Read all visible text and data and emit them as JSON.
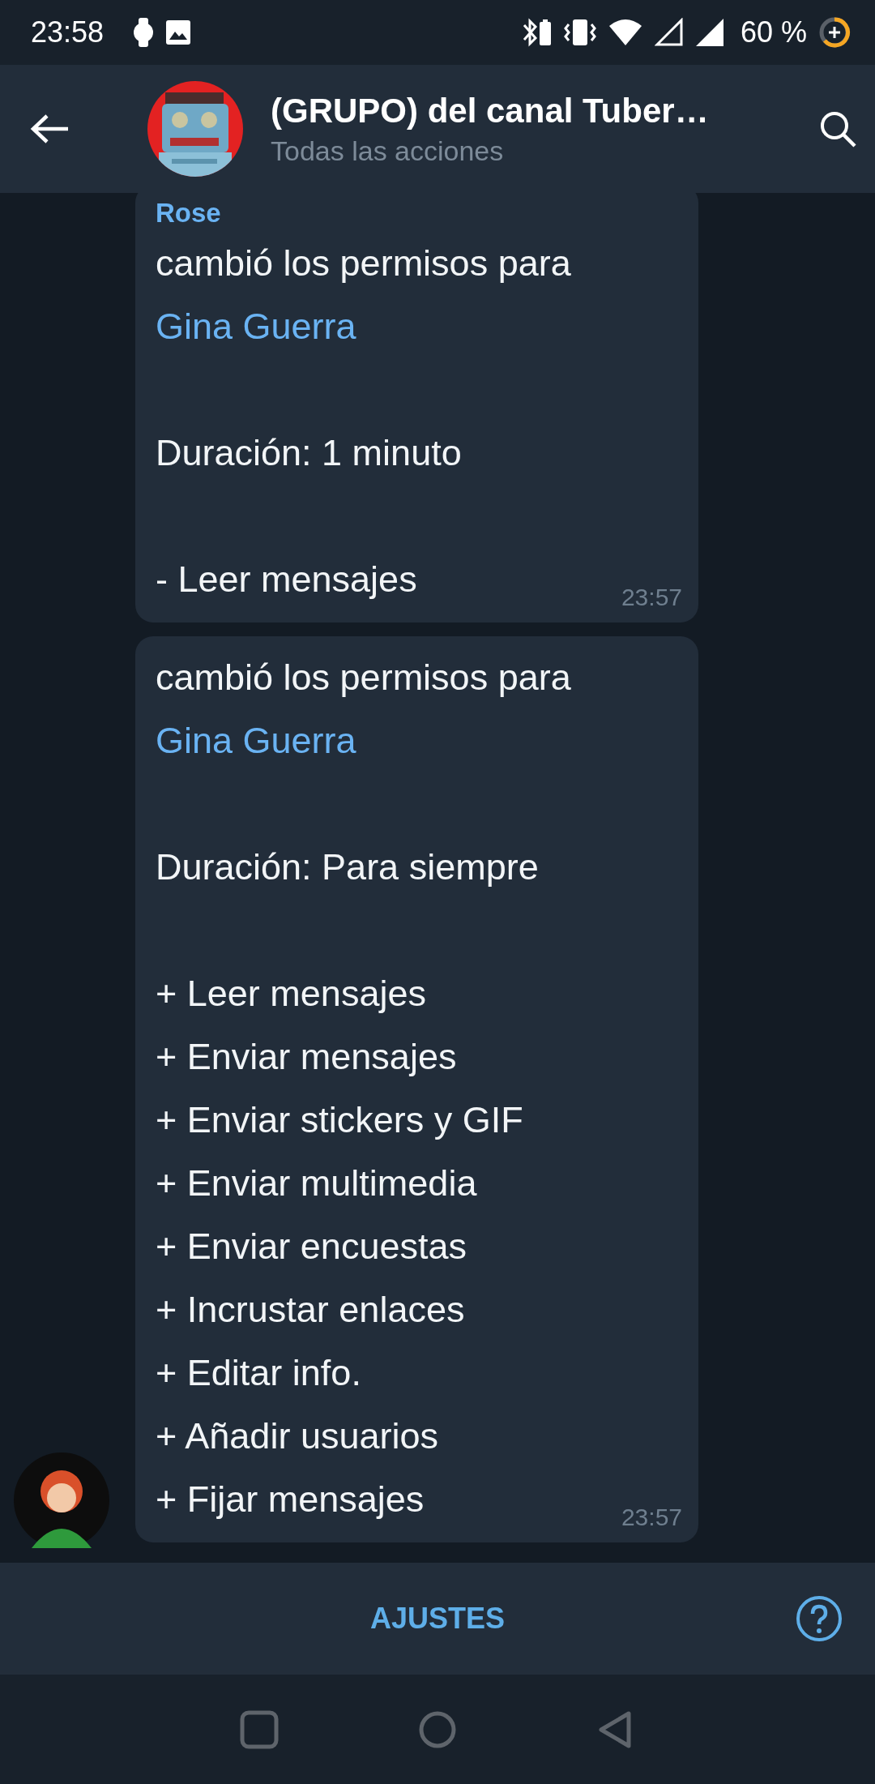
{
  "status_bar": {
    "time": "23:58",
    "battery": "60 %"
  },
  "header": {
    "title": "(GRUPO) del canal Tuber…",
    "subtitle": "Todas las acciones"
  },
  "messages": [
    {
      "sender": "Rose",
      "time": "23:57",
      "paragraphs": [
        [
          {
            "kind": "plain",
            "text": "cambió los permisos para"
          },
          {
            "kind": "link",
            "text": "Gina Guerra"
          }
        ],
        [
          {
            "kind": "plain",
            "text": "Duración: 1 minuto"
          }
        ],
        [
          {
            "kind": "plain",
            "text": "- Leer mensajes"
          }
        ]
      ]
    },
    {
      "time": "23:57",
      "paragraphs": [
        [
          {
            "kind": "plain",
            "text": "cambió los permisos para"
          },
          {
            "kind": "link",
            "text": "Gina Guerra"
          }
        ],
        [
          {
            "kind": "plain",
            "text": "Duración: Para siempre"
          }
        ],
        [
          {
            "kind": "plain",
            "text": "+ Leer mensajes"
          },
          {
            "kind": "plain",
            "text": "+ Enviar mensajes"
          },
          {
            "kind": "plain",
            "text": "+ Enviar stickers y GIF"
          },
          {
            "kind": "plain",
            "text": "+ Enviar multimedia"
          },
          {
            "kind": "plain",
            "text": "+ Enviar encuestas"
          },
          {
            "kind": "plain",
            "text": "+ Incrustar enlaces"
          },
          {
            "kind": "plain",
            "text": "+ Editar info."
          },
          {
            "kind": "plain",
            "text": "+ Añadir usuarios"
          },
          {
            "kind": "plain",
            "text": "+ Fijar mensajes"
          }
        ]
      ]
    }
  ],
  "bottom_bar": {
    "button": "AJUSTES"
  }
}
